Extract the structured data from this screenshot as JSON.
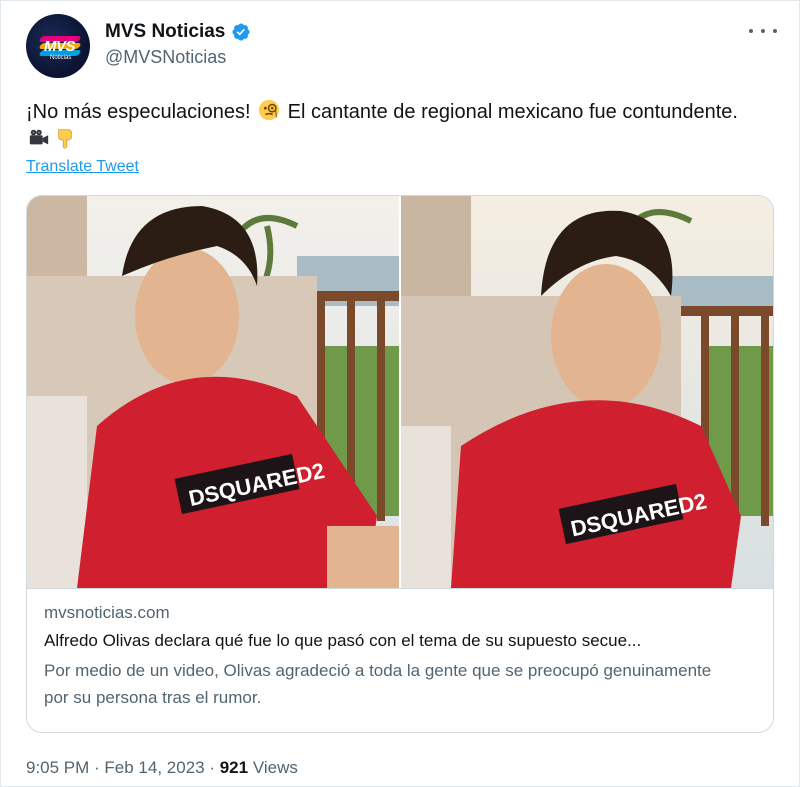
{
  "account": {
    "display_name": "MVS Noticias",
    "handle": "@MVSNoticias",
    "avatar_text": "MVS",
    "avatar_subtext": "Noticias",
    "verified_icon": "verified-badge-icon",
    "verified_color": "#1d9bf0"
  },
  "tweet": {
    "text_part1": "¡No más especulaciones! ",
    "text_part2": " El cantante de regional mexicano fue contundente. ",
    "emojis": [
      "face-with-monocle-icon",
      "movie-camera-icon",
      "pointing-down-icon"
    ],
    "translate_label": "Translate Tweet"
  },
  "card": {
    "domain": "mvsnoticias.com",
    "title": "Alfredo Olivas declara qué fue lo que pasó con el tema de su supuesto secue...",
    "description": "Por medio de un video, Olivas agradeció a toda la gente que se preocupó genuinamente por su persona tras el rumor.",
    "shirt_text": "DSQUARED2"
  },
  "footer": {
    "timestamp": "9:05 PM · Feb 14, 2023 · ",
    "views_count": "921",
    "views_label": " Views"
  },
  "colors": {
    "link": "#1d9bf0",
    "secondary_text": "#536471",
    "primary_text": "#0f1419",
    "border": "#cfd9de"
  }
}
